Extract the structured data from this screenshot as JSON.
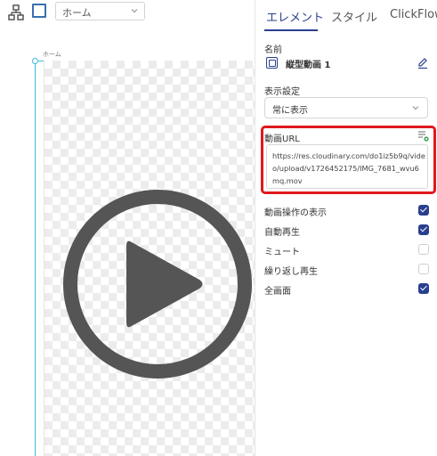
{
  "toolbar": {
    "page_select_value": "ホーム",
    "tree_icon": "sitemap-icon",
    "frame_icon": "square-icon"
  },
  "canvas": {
    "frame_label": "ホーム",
    "play_icon": "play-circle-icon"
  },
  "panel": {
    "tabs": [
      {
        "label": "エレメント",
        "active": true
      },
      {
        "label": "スタイル",
        "active": false
      },
      {
        "label": "ClickFlow",
        "active": false
      }
    ],
    "name_label": "名前",
    "name_value": "縦型動画 1",
    "display_label": "表示設定",
    "display_value": "常に表示",
    "video_url_label": "動画URL",
    "video_url_value": "https://res.cloudinary.com/do1iz5b9q/video/upload/v1726452175/IMG_7681_wvu6mq.mov",
    "options": [
      {
        "label": "動画操作の表示",
        "checked": true
      },
      {
        "label": "自動再生",
        "checked": true
      },
      {
        "label": "ミュート",
        "checked": false
      },
      {
        "label": "繰り返し再生",
        "checked": false
      },
      {
        "label": "全画面",
        "checked": true
      }
    ]
  },
  "colors": {
    "accent": "#2a3f8f",
    "highlight": "#e0191e",
    "guide": "#3fb9e0",
    "play": "#555555"
  }
}
